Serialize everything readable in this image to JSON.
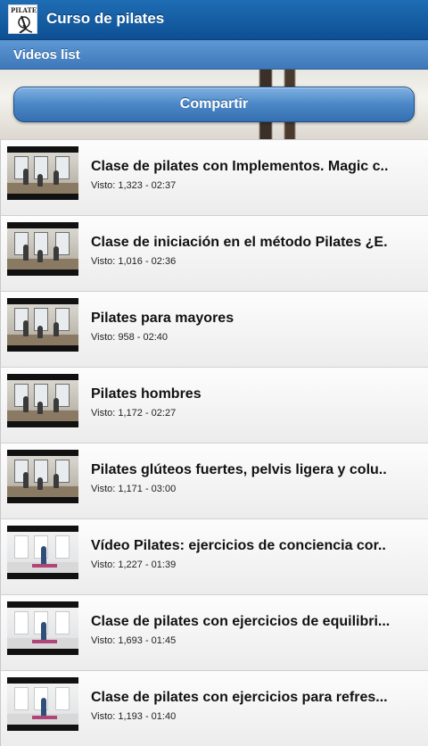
{
  "app": {
    "title": "Curso de pilates",
    "logo_text": "PILATES"
  },
  "subbar": {
    "label": "Videos list"
  },
  "share": {
    "label": "Compartir"
  },
  "videos": [
    {
      "title": "Clase de pilates con Implementos. Magic c..",
      "meta": "Visto: 1,323 - 02:37",
      "thumb_style": "studio-dark"
    },
    {
      "title": "Clase de iniciación en el método Pilates ¿E.",
      "meta": "Visto: 1,016 - 02:36",
      "thumb_style": "studio-dark"
    },
    {
      "title": "Pilates para mayores",
      "meta": "Visto: 958 - 02:40",
      "thumb_style": "studio-dark"
    },
    {
      "title": "Pilates hombres",
      "meta": "Visto: 1,172 - 02:27",
      "thumb_style": "studio-dark"
    },
    {
      "title": "Pilates glúteos fuertes, pelvis ligera y colu..",
      "meta": "Visto: 1,171 - 03:00",
      "thumb_style": "studio-dark"
    },
    {
      "title": "Vídeo Pilates: ejercicios de conciencia cor..",
      "meta": "Visto: 1,227 - 01:39",
      "thumb_style": "studio-light"
    },
    {
      "title": "Clase de pilates con ejercicios de equilibri...",
      "meta": "Visto: 1,693 - 01:45",
      "thumb_style": "studio-light"
    },
    {
      "title": "Clase de pilates con ejercicios para refres...",
      "meta": "Visto: 1,193 - 01:40",
      "thumb_style": "studio-light"
    }
  ],
  "colors": {
    "titlebar": "#1a63a8",
    "subbar": "#4f8ac8",
    "button": "#4b86c6"
  }
}
